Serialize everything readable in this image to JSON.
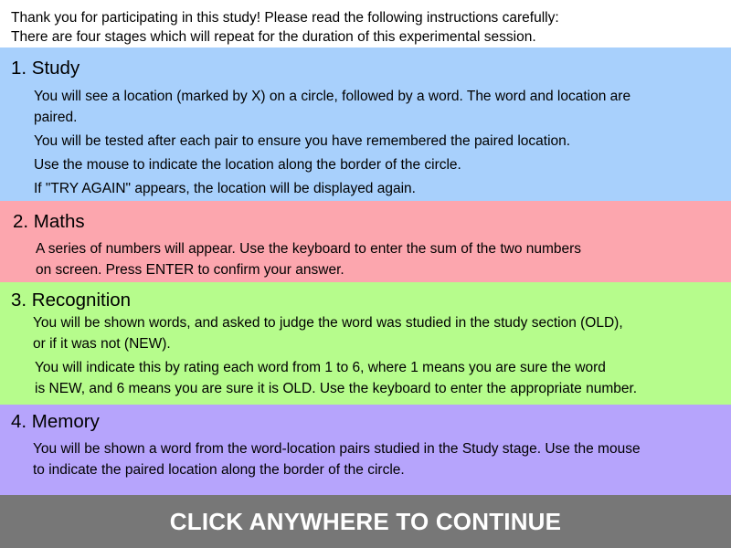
{
  "intro": {
    "line1": "Thank you for participating in this study! Please read the following instructions carefully:",
    "line2": "There are four stages which will repeat for the duration of this experimental session."
  },
  "stages": [
    {
      "title": "1. Study",
      "color": "#a8d0fc",
      "lines": [
        "You will see a location (marked by X) on a circle, followed by a word. The word and location are",
        "paired.",
        "You will be tested after each pair to ensure you have remembered the paired location.",
        "Use the mouse to indicate the location along the border of the circle.",
        "If \"TRY AGAIN\" appears, the location will be displayed again."
      ]
    },
    {
      "title": "2. Maths",
      "color": "#fca6ae",
      "lines": [
        "A series of numbers will appear. Use the keyboard to enter the sum of the two numbers",
        "on screen. Press ENTER to confirm your answer."
      ]
    },
    {
      "title": "3. Recognition",
      "color": "#b6fc8c",
      "lines": [
        "You will be shown words, and asked to judge the word was studied in the study section (OLD),",
        "or if it was not (NEW).",
        "You will indicate this by rating each word from 1 to 6, where 1 means you are sure the word",
        "is NEW, and 6 means you are sure it is OLD. Use the keyboard to enter the appropriate number."
      ]
    },
    {
      "title": "4. Memory",
      "color": "#b6a4fc",
      "lines": [
        "You will be shown a word from the word-location pairs studied in the Study stage. Use the mouse",
        "to indicate the paired location along the border of the circle."
      ]
    }
  ],
  "continue": {
    "label": "CLICK ANYWHERE TO CONTINUE",
    "color": "#777777"
  }
}
